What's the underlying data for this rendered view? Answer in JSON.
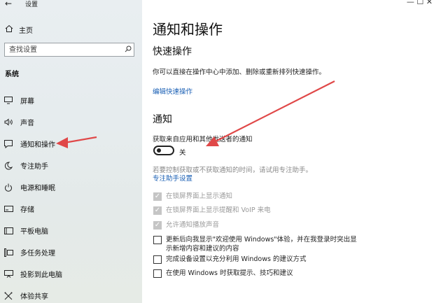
{
  "window": {
    "title": "设置",
    "controls": "—  ☐  ✕"
  },
  "sidebar": {
    "home_label": "主页",
    "search_placeholder": "查找设置",
    "section_label": "系统",
    "items": [
      {
        "label": "屏幕",
        "icon": "monitor-icon"
      },
      {
        "label": "声音",
        "icon": "speaker-icon"
      },
      {
        "label": "通知和操作",
        "icon": "notification-icon"
      },
      {
        "label": "专注助手",
        "icon": "moon-icon"
      },
      {
        "label": "电源和睡眠",
        "icon": "power-icon"
      },
      {
        "label": "存储",
        "icon": "storage-icon"
      },
      {
        "label": "平板电脑",
        "icon": "tablet-icon"
      },
      {
        "label": "多任务处理",
        "icon": "multitask-icon"
      },
      {
        "label": "投影到此电脑",
        "icon": "project-icon"
      },
      {
        "label": "体验共享",
        "icon": "share-icon"
      }
    ]
  },
  "main": {
    "title": "通知和操作",
    "quick_actions": {
      "heading": "快速操作",
      "description": "你可以直接在操作中心中添加、删除或重新排列快速操作。",
      "edit_link": "编辑快速操作"
    },
    "notifications": {
      "heading": "通知",
      "toggle_label": "获取来自应用和其他发送者的通知",
      "toggle_state": "关",
      "toggle_on": false,
      "focus_hint": "若要控制获取或不获取通知的时间，请试用专注助手。",
      "focus_link": "专注助手设置",
      "options": [
        {
          "label": "在锁屏界面上显示通知",
          "checked": true,
          "disabled": true
        },
        {
          "label": "在锁屏界面上显示提醒和 VoIP 来电",
          "checked": true,
          "disabled": true
        },
        {
          "label": "允许通知播放声音",
          "checked": true,
          "disabled": true
        },
        {
          "label": "更新后向我显示\"欢迎使用 Windows\"体验，并在我登录时突出显示新增内容和建议的内容",
          "checked": false,
          "disabled": false
        },
        {
          "label": "完成设备设置以充分利用 Windows 的建议方式",
          "checked": false,
          "disabled": false
        },
        {
          "label": "在使用 Windows 时获取提示、技巧和建议",
          "checked": false,
          "disabled": false
        }
      ]
    }
  },
  "annotations": {
    "arrow_color": "#e04848"
  }
}
